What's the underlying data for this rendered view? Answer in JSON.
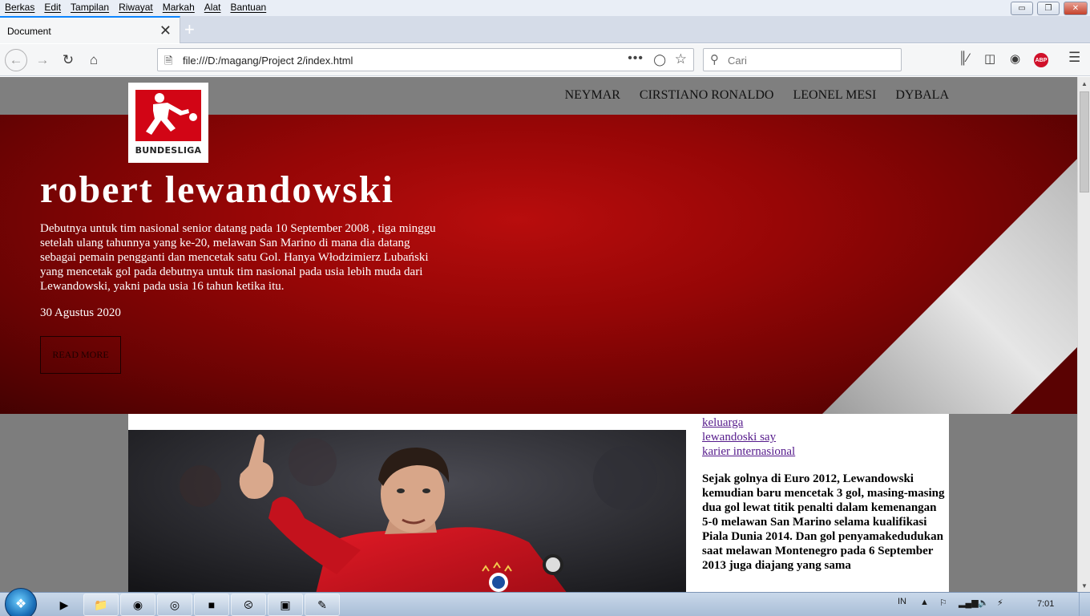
{
  "menubar": {
    "items": [
      "Berkas",
      "Edit",
      "Tampilan",
      "Riwayat",
      "Markah",
      "Alat",
      "Bantuan"
    ]
  },
  "window_controls": {
    "minimize": "▭",
    "restore": "❐",
    "close": "✕"
  },
  "tab": {
    "title": "Document",
    "close": "✕",
    "new_tab": "+"
  },
  "nav": {
    "url": "file:///D:/magang/Project 2/index.html",
    "search_placeholder": "Cari",
    "abp_label": "ABP"
  },
  "page": {
    "nav_links": [
      "NEYMAR",
      "CIRSTIANO RONALDO",
      "LEONEL MESI",
      "DYBALA"
    ],
    "logo_text": "BUNDESLIGA",
    "hero_title": "robert lewandowski",
    "hero_text": "Debutnya untuk tim nasional senior datang pada 10 September 2008 , tiga minggu setelah ulang tahunnya yang ke-20, melawan San Marino di mana dia datang sebagai pemain pengganti dan mencetak satu Gol. Hanya Włodzimierz Lubański yang mencetak gol pada debutnya untuk tim nasional pada usia lebih muda dari Lewandowski, yakni pada usia 16 tahun ketika itu.",
    "hero_date": "30 Agustus 2020",
    "read_more": "READ MORE",
    "side_links": [
      "keluarga",
      "lewandoski say",
      "karier internasional"
    ],
    "side_paragraph": "Sejak golnya di Euro 2012, Lewandowski kemudian baru mencetak 3 gol, masing-masing dua gol lewat titik penalti dalam kemenangan 5-0 melawan San Marino selama kualifikasi Piala Dunia 2014. Dan gol penyamakedudukan saat melawan Montenegro pada 6 September 2013 juga diajang yang sama"
  },
  "taskbar": {
    "language": "IN",
    "time": "7:01"
  },
  "colors": {
    "hero_red": "#960606",
    "header_gray": "#7f7f7f",
    "link_visited": "#551a8b",
    "tab_accent": "#0a84ff"
  }
}
